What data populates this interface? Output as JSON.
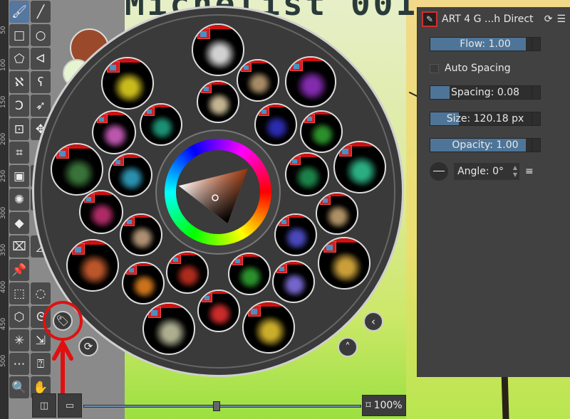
{
  "canvas": {
    "title_text": "Michelist 001"
  },
  "ruler": {
    "ticks": [
      "50",
      "100",
      "150",
      "200",
      "250",
      "300",
      "350",
      "400",
      "450",
      "500"
    ]
  },
  "toolbox": {
    "tools": [
      {
        "name": "freehand-brush",
        "glyph": "🖌"
      },
      {
        "name": "line",
        "glyph": "╱"
      },
      {
        "name": "rectangle",
        "glyph": "□"
      },
      {
        "name": "ellipse",
        "glyph": "○"
      },
      {
        "name": "polygon",
        "glyph": "⬠"
      },
      {
        "name": "polyline",
        "glyph": "ᐊ"
      },
      {
        "name": "bezier",
        "glyph": "ℵ"
      },
      {
        "name": "freehand-path",
        "glyph": "ʕ"
      },
      {
        "name": "dynamic-brush",
        "glyph": "Ͻ"
      },
      {
        "name": "multibrush",
        "glyph": "➶"
      },
      {
        "name": "transform",
        "glyph": "⊡"
      },
      {
        "name": "move",
        "glyph": "✥"
      },
      {
        "name": "crop",
        "glyph": "⌗"
      },
      {
        "name": "blank",
        "glyph": ""
      },
      {
        "name": "gradient",
        "glyph": "▣"
      },
      {
        "name": "color-picker",
        "glyph": "✎"
      },
      {
        "name": "smart-patch",
        "glyph": "✺"
      },
      {
        "name": "assistant",
        "glyph": "✂"
      },
      {
        "name": "fill",
        "glyph": "◆"
      },
      {
        "name": "blank2",
        "glyph": ""
      },
      {
        "name": "measure-assistant",
        "glyph": "⌧"
      },
      {
        "name": "measure",
        "glyph": "◿"
      },
      {
        "name": "reference",
        "glyph": "📌"
      },
      {
        "name": "blank3",
        "glyph": ""
      },
      {
        "name": "rect-select",
        "glyph": "⬚"
      },
      {
        "name": "ellipse-select",
        "glyph": "◌"
      },
      {
        "name": "polygon-select",
        "glyph": "⬡"
      },
      {
        "name": "outline-select",
        "glyph": "ᘓ"
      },
      {
        "name": "contiguous-select",
        "glyph": "✳"
      },
      {
        "name": "similar-select",
        "glyph": "⇲"
      },
      {
        "name": "bezier-select",
        "glyph": "⋯"
      },
      {
        "name": "magnetic-select",
        "glyph": "⍰"
      },
      {
        "name": "zoom",
        "glyph": "🔍"
      },
      {
        "name": "pan",
        "glyph": "✋"
      }
    ]
  },
  "palette": {
    "presets": [
      {
        "color": "#e8e8e8"
      },
      {
        "color": "#e0d020"
      },
      {
        "color": "#b89a70"
      },
      {
        "color": "#9030c0"
      },
      {
        "color": "#d8c8a0"
      },
      {
        "color": "#d060c0"
      },
      {
        "color": "#20a080"
      },
      {
        "color": "#3030c0"
      },
      {
        "color": "#30a030"
      },
      {
        "color": "#408040"
      },
      {
        "color": "#30a0c0"
      },
      {
        "color": "#209050"
      },
      {
        "color": "#30c090"
      },
      {
        "color": "#c03070"
      },
      {
        "color": "#c0a070"
      },
      {
        "color": "#c0a080"
      },
      {
        "color": "#5050d0"
      },
      {
        "color": "#d06030"
      },
      {
        "color": "#e0b040"
      },
      {
        "color": "#e08020"
      },
      {
        "color": "#c03020"
      },
      {
        "color": "#30a030"
      },
      {
        "color": "#8070e0"
      },
      {
        "color": "#e03030"
      },
      {
        "color": "#c0c0a0"
      },
      {
        "color": "#e0c030"
      }
    ],
    "foreground_color": "#9a4a2a",
    "background_color": "#e6f5d0",
    "tag_button": "tag-icon",
    "reset_button": "reset-icon",
    "collapse_button": "chevron-left-icon",
    "up_button": "chevron-up-icon"
  },
  "panel": {
    "preset_name": "ART 4 G ...h Direct",
    "flow": {
      "label": "Flow: 1.00",
      "value": 1.0
    },
    "auto_spacing": {
      "label": "Auto Spacing",
      "checked": false
    },
    "spacing": {
      "label": "Spacing: 0.08",
      "value": 0.08
    },
    "size": {
      "label": "Size: 120.18 px",
      "fraction": 0.3
    },
    "opacity": {
      "label": "Opacity: 1.00",
      "value": 1.0
    },
    "angle": {
      "label": "Angle: 0°"
    }
  },
  "bottom": {
    "zoom": "100%",
    "zoom_fraction": 0.48
  }
}
